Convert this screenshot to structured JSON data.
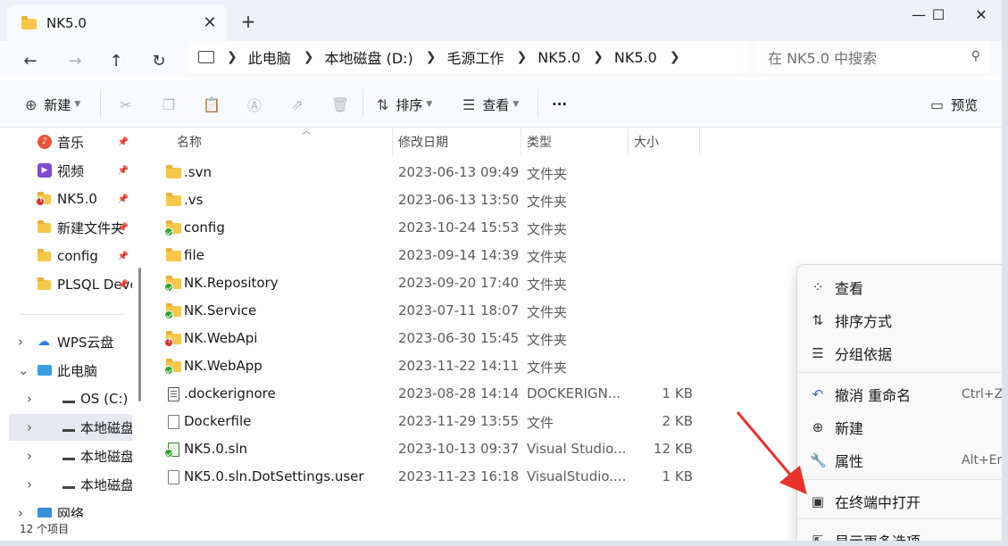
{
  "window": {
    "tab_title": "NK5.0",
    "tab_close": "✕",
    "tab_add": "+",
    "minimize": "—",
    "maximize": "☐",
    "close": "✕"
  },
  "nav": {
    "back": "←",
    "forward": "→",
    "up": "↑",
    "refresh": "↻"
  },
  "breadcrumbs": [
    "此电脑",
    "本地磁盘 (D:)",
    "毛源工作",
    "NK5.0",
    "NK5.0"
  ],
  "search": {
    "placeholder": "在 NK5.0 中搜索"
  },
  "toolbar": {
    "new_label": "新建",
    "sort_label": "排序",
    "view_label": "查看",
    "more_label": "···",
    "preview_label": "预览"
  },
  "sidebar": {
    "quick_access": [
      {
        "label": "音乐",
        "icon": "music-icon"
      },
      {
        "label": "视频",
        "icon": "video-icon"
      },
      {
        "label": "NK5.0",
        "icon": "folder-icon"
      },
      {
        "label": "新建文件夹",
        "icon": "folder-icon"
      },
      {
        "label": "config",
        "icon": "folder-icon"
      },
      {
        "label": "PLSQL Deve",
        "icon": "folder-icon"
      }
    ],
    "tree": [
      {
        "label": "WPS云盘",
        "icon": "cloud-icon"
      },
      {
        "label": "此电脑",
        "icon": "computer-icon"
      },
      {
        "label": "OS (C:)",
        "icon": "drive-icon"
      },
      {
        "label": "本地磁盘 (D",
        "icon": "drive-icon"
      },
      {
        "label": "本地磁盘 (E",
        "icon": "drive-icon"
      },
      {
        "label": "本地磁盘 (F",
        "icon": "drive-icon"
      },
      {
        "label": "网络",
        "icon": "network-icon"
      }
    ]
  },
  "status": {
    "item_count": "12 个项目"
  },
  "columns": {
    "name": "名称",
    "date": "修改日期",
    "type": "类型",
    "size": "大小"
  },
  "files": [
    {
      "name": ".svn",
      "date": "2023-06-13 09:49",
      "type": "文件夹",
      "size": "",
      "kind": "folder",
      "badge": ""
    },
    {
      "name": ".vs",
      "date": "2023-06-13 13:50",
      "type": "文件夹",
      "size": "",
      "kind": "folder",
      "badge": ""
    },
    {
      "name": "config",
      "date": "2023-10-24 15:53",
      "type": "文件夹",
      "size": "",
      "kind": "folder",
      "badge": "ok"
    },
    {
      "name": "file",
      "date": "2023-09-14 14:39",
      "type": "文件夹",
      "size": "",
      "kind": "folder",
      "badge": ""
    },
    {
      "name": "NK.Repository",
      "date": "2023-09-20 17:40",
      "type": "文件夹",
      "size": "",
      "kind": "folder",
      "badge": "ok"
    },
    {
      "name": "NK.Service",
      "date": "2023-07-11 18:07",
      "type": "文件夹",
      "size": "",
      "kind": "folder",
      "badge": "ok"
    },
    {
      "name": "NK.WebApi",
      "date": "2023-06-30 15:45",
      "type": "文件夹",
      "size": "",
      "kind": "folder",
      "badge": "err"
    },
    {
      "name": "NK.WebApp",
      "date": "2023-11-22 14:11",
      "type": "文件夹",
      "size": "",
      "kind": "folder",
      "badge": "ok"
    },
    {
      "name": ".dockerignore",
      "date": "2023-08-28 14:14",
      "type": "DOCKERIGN...",
      "size": "1 KB",
      "kind": "notepad",
      "badge": ""
    },
    {
      "name": "Dockerfile",
      "date": "2023-11-29 13:55",
      "type": "文件",
      "size": "2 KB",
      "kind": "doc",
      "badge": ""
    },
    {
      "name": "NK5.0.sln",
      "date": "2023-10-13 09:37",
      "type": "Visual Studio...",
      "size": "12 KB",
      "kind": "sln",
      "badge": "ok"
    },
    {
      "name": "NK5.0.sln.DotSettings.user",
      "date": "2023-11-23 16:18",
      "type": "VisualStudio....",
      "size": "1 KB",
      "kind": "doc",
      "badge": ""
    }
  ],
  "context_menu": [
    {
      "label": "查看",
      "icon": "grid-icon",
      "glyph": "⁘",
      "shortcut": ""
    },
    {
      "label": "排序方式",
      "icon": "sort-icon",
      "glyph": "⇅",
      "shortcut": ""
    },
    {
      "label": "分组依据",
      "icon": "group-icon",
      "glyph": "☰",
      "shortcut": ""
    },
    {
      "label": "撤消 重命名",
      "icon": "undo-icon",
      "glyph": "↶",
      "shortcut": "Ctrl+Z"
    },
    {
      "label": "新建",
      "icon": "plus-circle-icon",
      "glyph": "⊕",
      "shortcut": ""
    },
    {
      "label": "属性",
      "icon": "wrench-icon",
      "glyph": "🔧",
      "shortcut": "Alt+Enter"
    },
    {
      "label": "在终端中打开",
      "icon": "terminal-icon",
      "glyph": "▣",
      "shortcut": ""
    },
    {
      "label": "显示更多选项",
      "icon": "more-options-icon",
      "glyph": "⇱",
      "shortcut": ""
    }
  ],
  "colors": {
    "annotation_arrow": "#e8322b",
    "folder": "#f5c84c",
    "badge_ok": "#2aa52a",
    "badge_error": "#d6372c"
  }
}
